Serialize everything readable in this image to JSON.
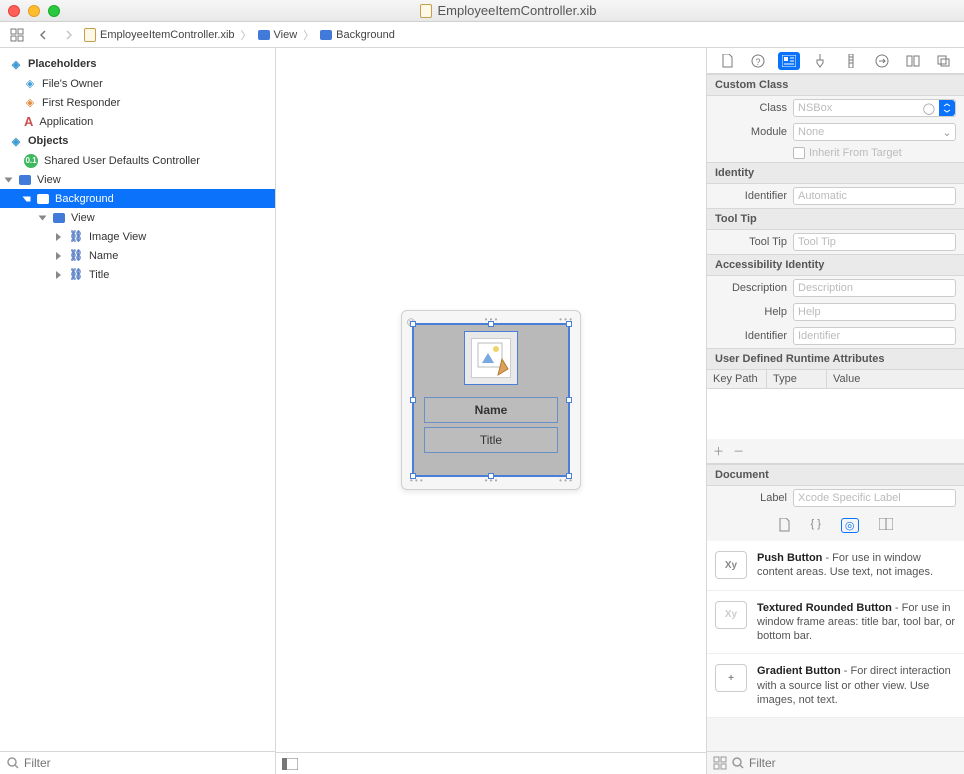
{
  "window": {
    "title": "EmployeeItemController.xib"
  },
  "jumpbar": {
    "file": "EmployeeItemController.xib",
    "view": "View",
    "background": "Background"
  },
  "navigator": {
    "placeholders_h": "Placeholders",
    "files_owner": "File's Owner",
    "first_responder": "First Responder",
    "application": "Application",
    "objects_h": "Objects",
    "shared_ud": "Shared User Defaults Controller",
    "view": "View",
    "background": "Background",
    "inner_view": "View",
    "image_view": "Image View",
    "name": "Name",
    "title": "Title",
    "filter_ph": "Filter"
  },
  "canvas": {
    "name_label": "Name",
    "title_label": "Title"
  },
  "inspector": {
    "custom_class_h": "Custom Class",
    "class_label": "Class",
    "class_value": "NSBox",
    "module_label": "Module",
    "module_value": "None",
    "inherit_label": "Inherit From Target",
    "identity_h": "Identity",
    "identifier_label": "Identifier",
    "identifier_ph": "Automatic",
    "tooltip_h": "Tool Tip",
    "tooltip_label": "Tool Tip",
    "tooltip_ph": "Tool Tip",
    "acc_h": "Accessibility Identity",
    "desc_label": "Description",
    "desc_ph": "Description",
    "help_label": "Help",
    "help_ph": "Help",
    "acc_id_label": "Identifier",
    "acc_id_ph": "Identifier",
    "runtime_h": "User Defined Runtime Attributes",
    "rt_key": "Key Path",
    "rt_type": "Type",
    "rt_value": "Value",
    "document_h": "Document",
    "doc_label_label": "Label",
    "doc_label_ph": "Xcode Specific Label"
  },
  "library": {
    "push_title": "Push Button",
    "push_desc": " - For use in window content areas. Use text, not images.",
    "push_thumb": "Xy",
    "textured_title": "Textured Rounded Button",
    "textured_desc": " - For use in window frame areas: title bar, tool bar, or bottom bar.",
    "textured_thumb": "Xy",
    "gradient_title": "Gradient Button",
    "gradient_desc": " - For direct interaction with a source list or other view. Use images, not text.",
    "gradient_thumb": "+",
    "filter_ph": "Filter"
  }
}
